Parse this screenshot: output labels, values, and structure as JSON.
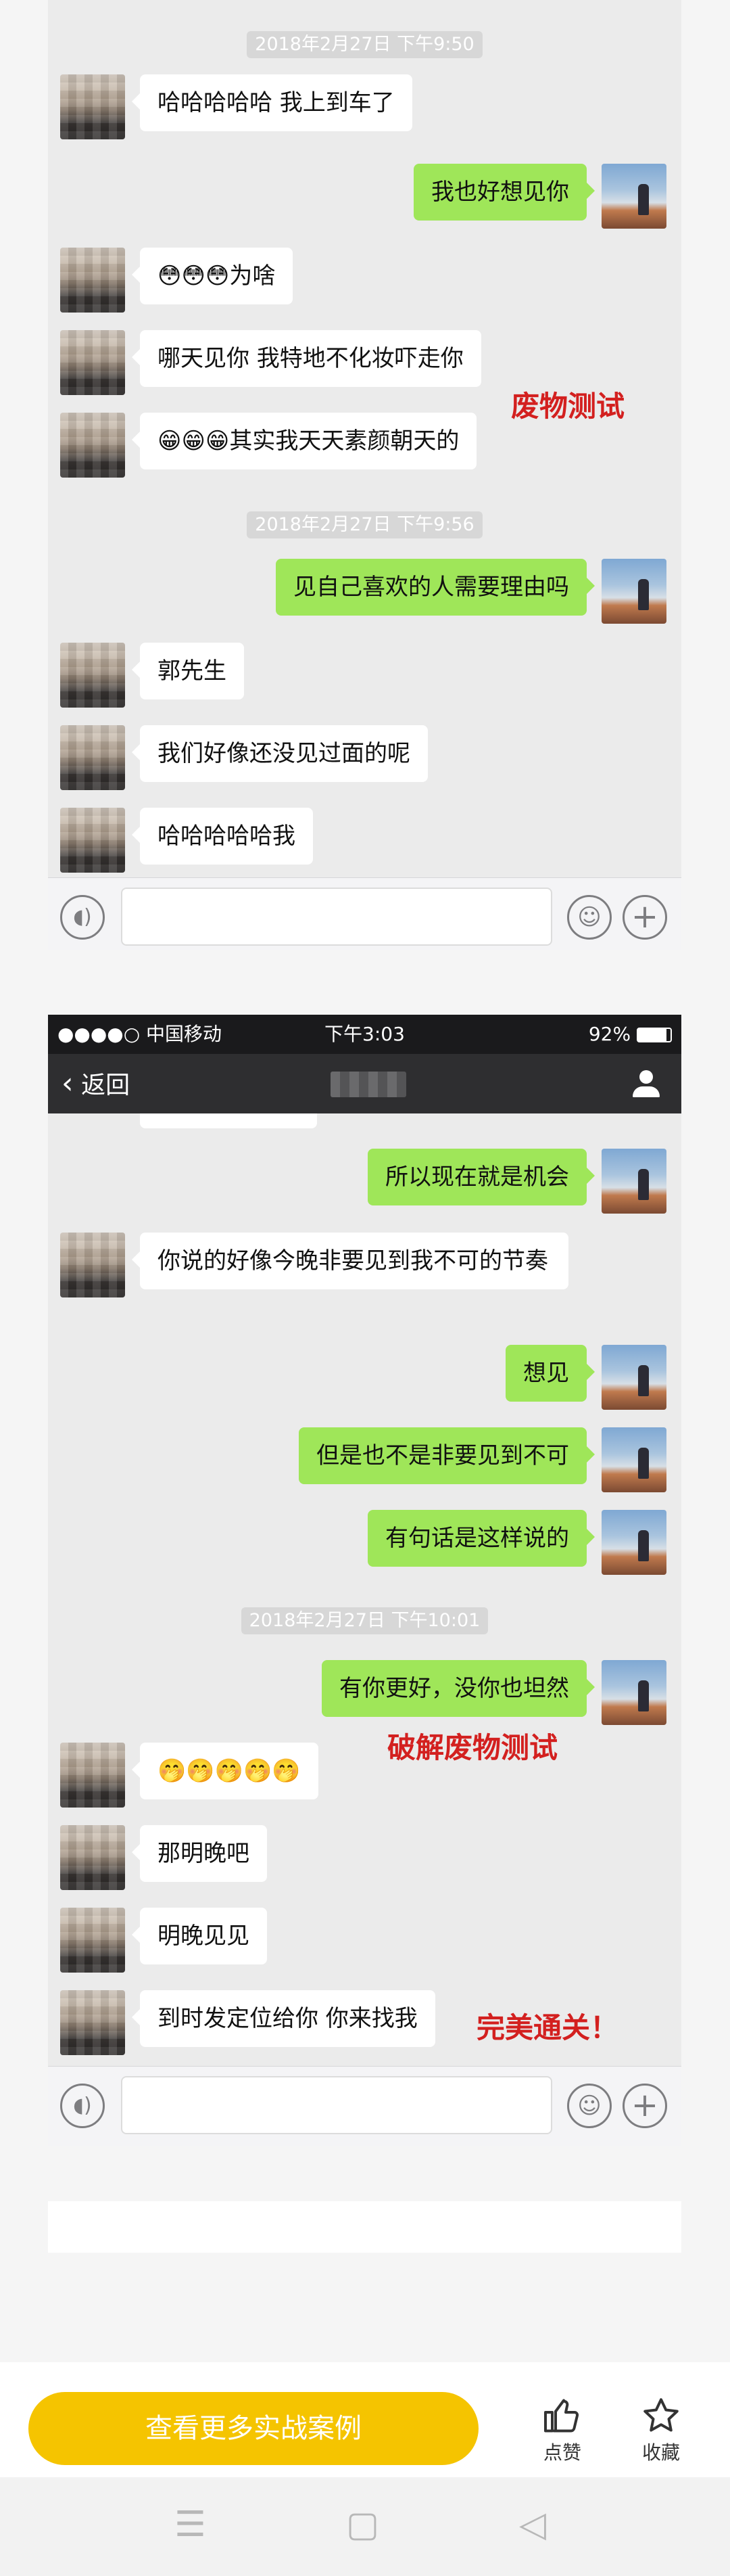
{
  "chat1": {
    "timestamp1": "2018年2月27日 下午9:50",
    "msg1": "哈哈哈哈哈 我上到车了",
    "msg2": "我也好想见你",
    "msg3_emoji": "😳😳😳",
    "msg3_text": "为啥",
    "msg4": "哪天见你 我特地不化妆吓走你",
    "msg5_emoji": "😁😁😁",
    "msg5_text": "其实我天天素颜朝天的",
    "annotation": "废物测试",
    "timestamp2": "2018年2月27日 下午9:56",
    "msg6": "见自己喜欢的人需要理由吗",
    "msg7": "郭先生",
    "msg8": "我们好像还没见过面的呢",
    "msg9": "哈哈哈哈哈我"
  },
  "chat2": {
    "status": {
      "carrier": "●●●●○ 中国移动",
      "time": "下午3:03",
      "battery": "92%"
    },
    "nav": {
      "back_label": "返回"
    },
    "msg1": "所以现在就是机会",
    "msg2": "你说的好像今晚非要见到我不可的节奏",
    "msg3": "想见",
    "msg4": "但是也不是非要见到不可",
    "msg5": "有句话是这样说的",
    "timestamp": "2018年2月27日 下午10:01",
    "msg6": "有你更好，没你也坦然",
    "annotation1": "破解废物测试",
    "msg7_emoji": "🤭🤭🤭🤭🤭",
    "msg8": "那明晚吧",
    "msg9": "明晚见见",
    "msg10": "到时发定位给你 你来找我",
    "annotation2": "完美通关！"
  },
  "cta": {
    "button_label": "查看更多实战案例",
    "like_label": "点赞",
    "like_icon": "thumbs-up-icon",
    "favorite_label": "收藏",
    "favorite_icon": "star-icon"
  },
  "sysnav": {
    "menu_icon": "☰",
    "home_icon": "▢",
    "back_icon": "◁"
  }
}
